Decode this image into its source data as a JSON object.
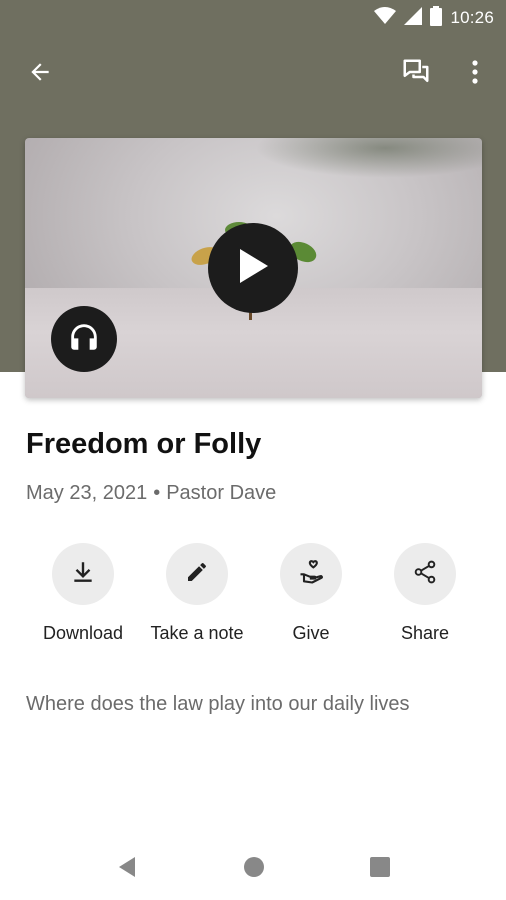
{
  "status_bar": {
    "time": "10:26",
    "icons": [
      "wifi-icon",
      "signal-icon",
      "battery-icon"
    ]
  },
  "toolbar": {
    "back_icon": "arrow-left-icon",
    "right_icons": [
      "chat-bubbles-icon",
      "more-vert-icon"
    ]
  },
  "media": {
    "play_icon": "play-icon",
    "audio_icon": "headphones-icon"
  },
  "sermon": {
    "title": "Freedom or Folly",
    "date": "May 23, 2021",
    "separator": "•",
    "speaker": "Pastor Dave",
    "description": "Where does the law play into our daily lives"
  },
  "actions": [
    {
      "label": "Download",
      "icon": "download-icon"
    },
    {
      "label": "Take a note",
      "icon": "pencil-icon"
    },
    {
      "label": "Give",
      "icon": "give-heart-hand-icon"
    },
    {
      "label": "Share",
      "icon": "share-icon"
    }
  ],
  "nav": {
    "icons": [
      "nav-back-icon",
      "nav-home-icon",
      "nav-recents-icon"
    ]
  },
  "colors": {
    "header": "#6f6f60",
    "action_circle": "#ececec",
    "play_button": "#1c1c1c",
    "secondary_text": "#6b6b6b"
  }
}
